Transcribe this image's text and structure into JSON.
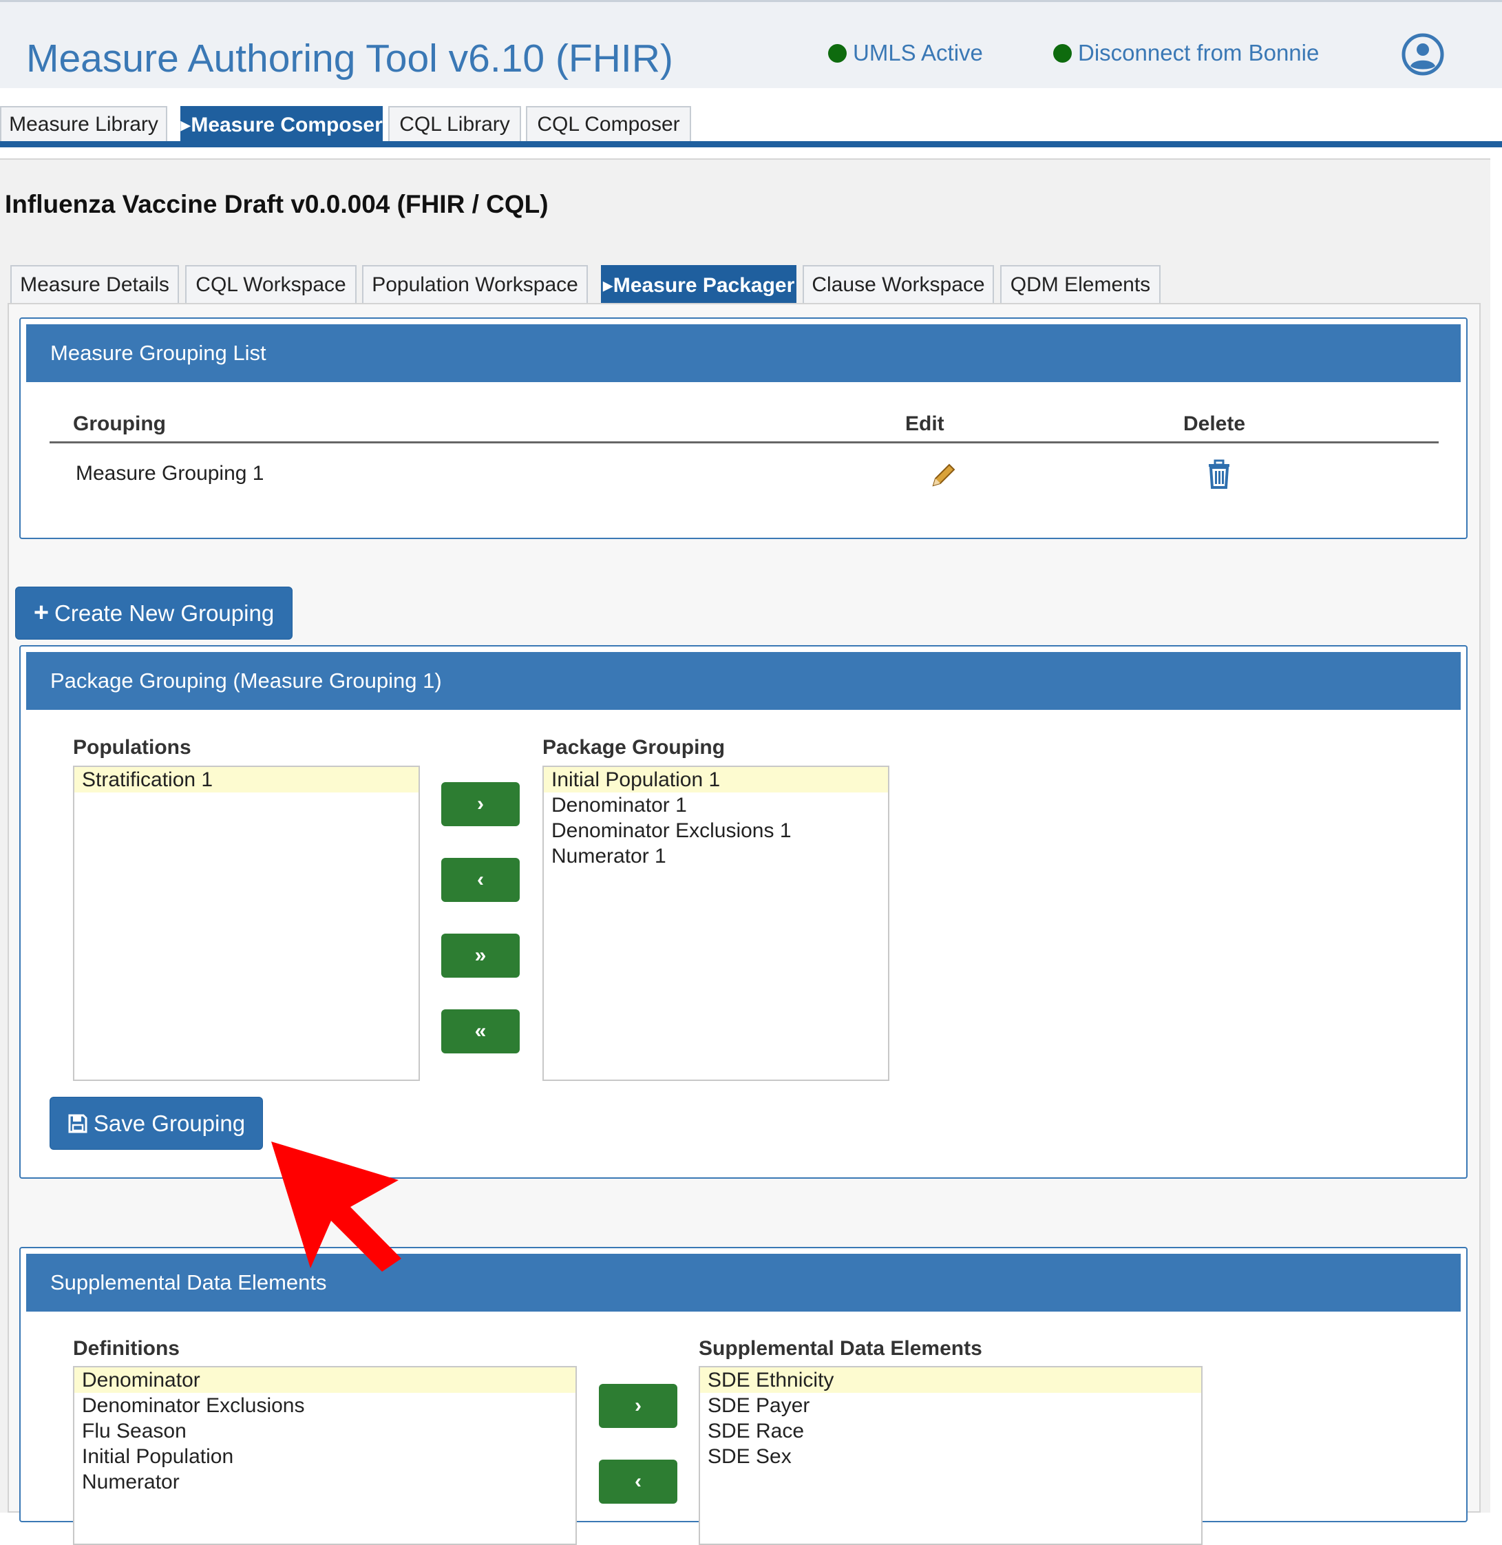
{
  "app": {
    "title": "Measure Authoring Tool v6.10 (FHIR)",
    "umls_status": "UMLS Active",
    "bonnie_status": "Disconnect from Bonnie",
    "status_color": "#0e6b0e",
    "user_icon": "user-circle-icon"
  },
  "main_tabs": [
    {
      "label": "Measure Library"
    },
    {
      "label": "▸Measure Composer",
      "active": true
    },
    {
      "label": "CQL Library"
    },
    {
      "label": "CQL Composer"
    }
  ],
  "measure": {
    "title": "Influenza Vaccine Draft v0.0.004 (FHIR / CQL)"
  },
  "sub_tabs": [
    {
      "label": "Measure Details"
    },
    {
      "label": "CQL Workspace"
    },
    {
      "label": "Population Workspace"
    },
    {
      "label": "▸Measure Packager",
      "active": true
    },
    {
      "label": "Clause Workspace"
    },
    {
      "label": "QDM Elements"
    }
  ],
  "grouping_list": {
    "heading": "Measure Grouping List",
    "columns": {
      "grouping": "Grouping",
      "edit": "Edit",
      "delete": "Delete"
    },
    "rows": [
      {
        "name": "Measure Grouping 1",
        "edit_icon": "pencil-icon",
        "delete_icon": "trash-icon"
      }
    ]
  },
  "create_button": {
    "label": "Create New Grouping",
    "icon": "plus-icon"
  },
  "package_grouping": {
    "heading": "Package Grouping (Measure Grouping 1)",
    "populations_label": "Populations",
    "populations": [
      "Stratification 1"
    ],
    "package_label": "Package Grouping",
    "package_items": [
      "Initial Population 1",
      "Denominator 1",
      "Denominator Exclusions 1",
      "Numerator 1"
    ],
    "buttons": {
      "add": "›",
      "remove": "‹",
      "add_all": "»",
      "remove_all": "«"
    },
    "save_label": "Save Grouping",
    "save_icon": "floppy-disk-icon"
  },
  "supplemental": {
    "heading": "Supplemental Data Elements",
    "definitions_label": "Definitions",
    "definitions": [
      "Denominator",
      "Denominator Exclusions",
      "Flu Season",
      "Initial Population",
      "Numerator"
    ],
    "sde_label": "Supplemental Data Elements",
    "sde_items": [
      "SDE Ethnicity",
      "SDE Payer",
      "SDE Race",
      "SDE Sex"
    ],
    "buttons": {
      "add": "›",
      "remove": "‹"
    }
  },
  "colors": {
    "brand_blue": "#3a78b5",
    "active_tab": "#1f5f9e",
    "arrow_button": "#2d7d32",
    "selected_item": "#fdfbd0",
    "annotation_arrow": "#ff0000"
  },
  "annotation": {
    "icon": "red-arrow-icon"
  }
}
